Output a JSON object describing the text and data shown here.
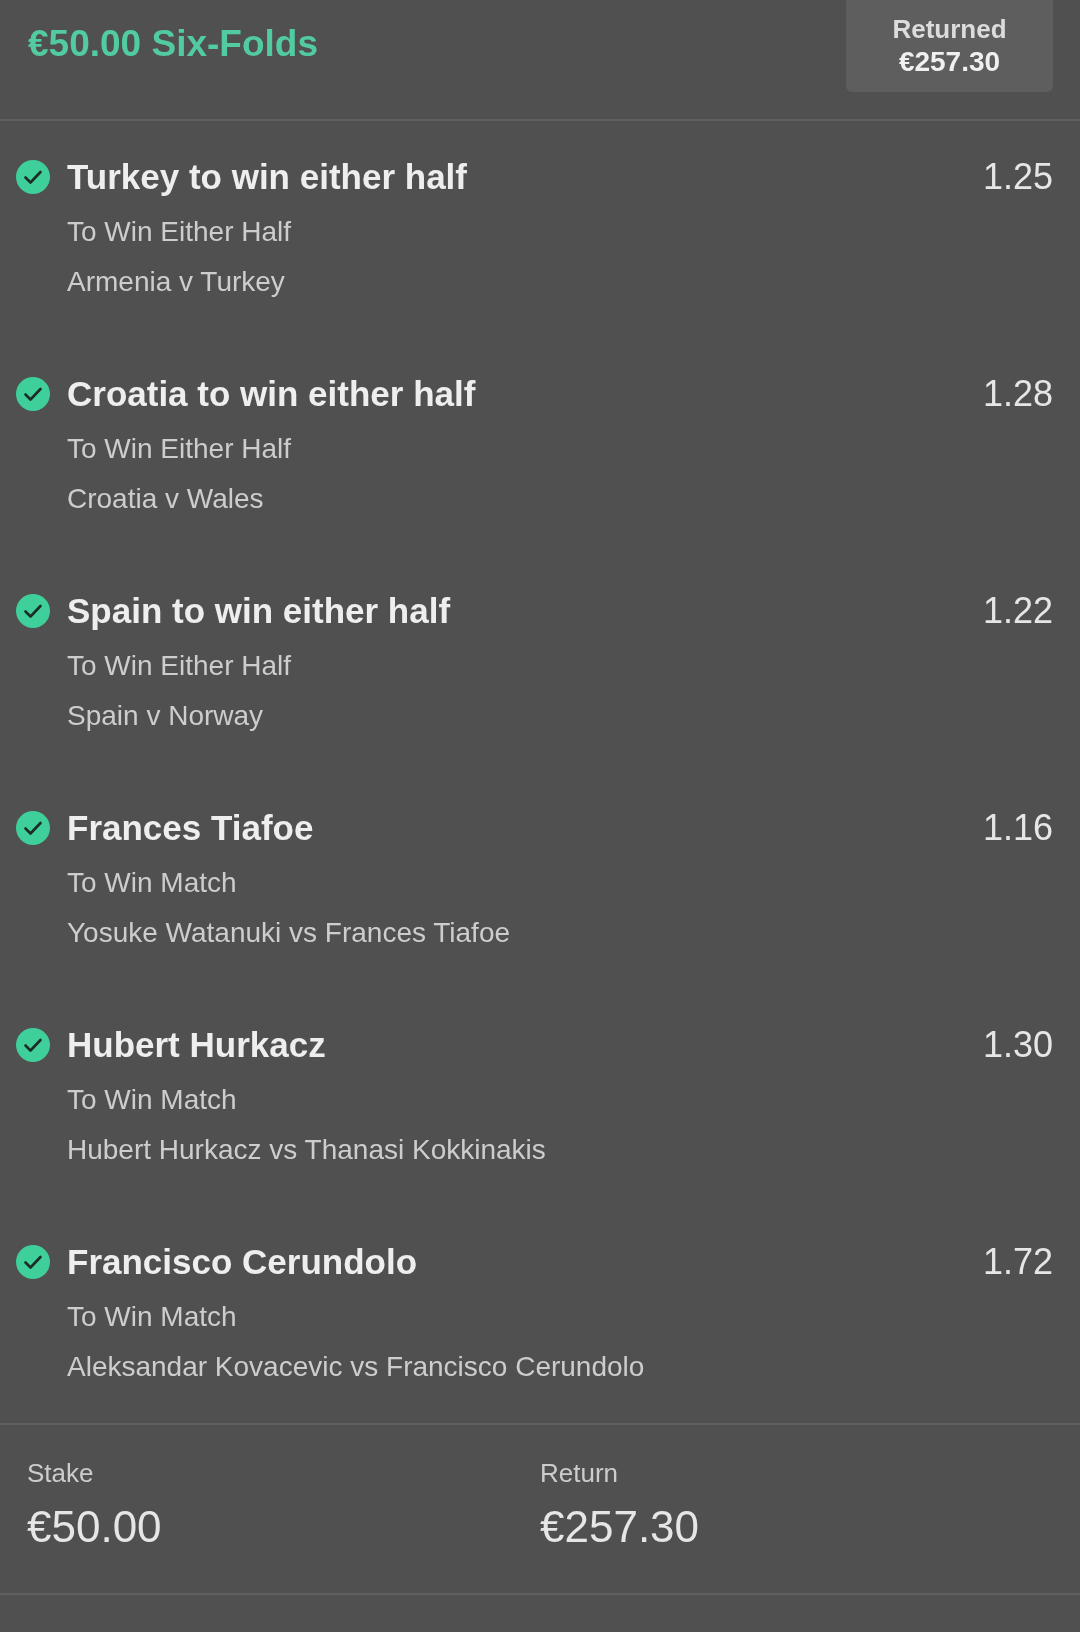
{
  "header": {
    "title": "€50.00 Six-Folds",
    "returned_badge": {
      "label": "Returned",
      "amount": "€257.30"
    }
  },
  "selections": [
    {
      "name": "Turkey to win either half",
      "market": "To Win Either Half",
      "event": "Armenia v Turkey",
      "odds": "1.25",
      "won": true
    },
    {
      "name": "Croatia to win either half",
      "market": "To Win Either Half",
      "event": "Croatia v Wales",
      "odds": "1.28",
      "won": true
    },
    {
      "name": "Spain to win either half",
      "market": "To Win Either Half",
      "event": "Spain v Norway",
      "odds": "1.22",
      "won": true
    },
    {
      "name": "Frances Tiafoe",
      "market": "To Win Match",
      "event": "Yosuke Watanuki vs Frances Tiafoe",
      "odds": "1.16",
      "won": true
    },
    {
      "name": "Hubert Hurkacz",
      "market": "To Win Match",
      "event": "Hubert Hurkacz vs Thanasi Kokkinakis",
      "odds": "1.30",
      "won": true
    },
    {
      "name": "Francisco Cerundolo",
      "market": "To Win Match",
      "event": "Aleksandar Kovacevic vs Francisco Cerundolo",
      "odds": "1.72",
      "won": true
    }
  ],
  "summary": {
    "stake": {
      "label": "Stake",
      "value": "€50.00"
    },
    "return": {
      "label": "Return",
      "value": "€257.30"
    }
  }
}
